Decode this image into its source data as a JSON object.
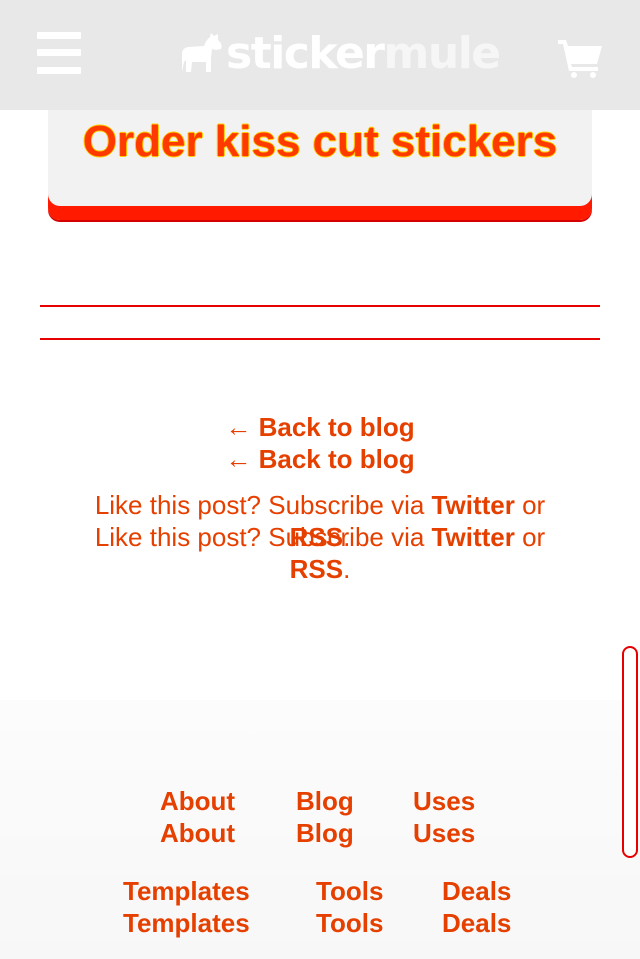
{
  "header": {
    "logo": {
      "part1": "sticker",
      "part2": "mule"
    },
    "menu_icon": "hamburger-menu-icon",
    "cart_icon": "shopping-cart-icon"
  },
  "cta": {
    "label": "Order kiss cut stickers"
  },
  "blog": {
    "back_link": "← Back to blog",
    "subscribe_prefix": "Like this post? Subscribe via ",
    "twitter_link": "Twitter",
    "or_text": " or",
    "rss_link": "RSS",
    "period": "."
  },
  "footer": {
    "row1": [
      "About",
      "Blog",
      "Uses"
    ],
    "row2": [
      "Templates",
      "Tools",
      "Deals"
    ]
  },
  "colors": {
    "accent": "#e64000",
    "header_bg": "#e8e8e8",
    "cta_red": "#ff1a00"
  }
}
